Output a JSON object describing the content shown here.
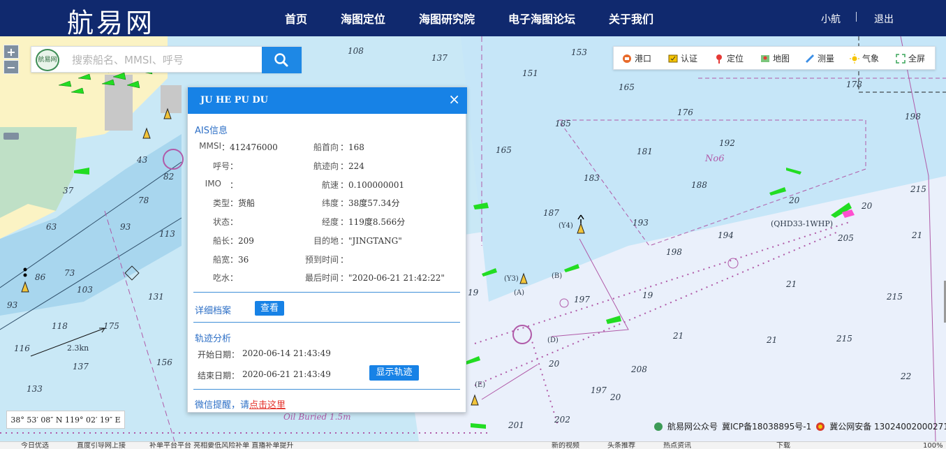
{
  "header": {
    "logo": "航易网",
    "nav": [
      "首页",
      "海图定位",
      "海图研究院",
      "电子海图论坛",
      "关于我们"
    ],
    "user": "小航",
    "logout": "退出"
  },
  "search": {
    "placeholder": "搜索船名、MMSI、呼号",
    "logo_text": "航易网"
  },
  "zoom": {
    "in": "+",
    "out": "−"
  },
  "toolbar": [
    {
      "label": "港口",
      "icon": "harbor-icon"
    },
    {
      "label": "认证",
      "icon": "certify-icon"
    },
    {
      "label": "定位",
      "icon": "location-pin-icon"
    },
    {
      "label": "地图",
      "icon": "map-icon"
    },
    {
      "label": "测量",
      "icon": "ruler-icon"
    },
    {
      "label": "气象",
      "icon": "sun-icon"
    },
    {
      "label": "全屏",
      "icon": "fullscreen-icon"
    }
  ],
  "popup": {
    "title": "JU HE PU DU",
    "close": "×",
    "ais_title": "AIS信息",
    "left_fields": [
      {
        "label": "MMSI",
        "value": "412476000"
      },
      {
        "label": "呼号",
        "value": ""
      },
      {
        "label": "IMO",
        "value": ""
      },
      {
        "label": "类型",
        "value": "货船"
      },
      {
        "label": "状态",
        "value": ""
      },
      {
        "label": "船长",
        "value": "209"
      },
      {
        "label": "船宽",
        "value": "36"
      },
      {
        "label": "吃水",
        "value": ""
      }
    ],
    "right_fields": [
      {
        "label": "船首向",
        "value": "168"
      },
      {
        "label": "航迹向",
        "value": "224"
      },
      {
        "label": "航速",
        "value": "0.100000001"
      },
      {
        "label": "纬度",
        "value": "38度57.34分"
      },
      {
        "label": "经度",
        "value": "119度8.566分"
      },
      {
        "label": "目的地",
        "value": "\"JINGTANG\""
      },
      {
        "label": "预到时间",
        "value": ""
      },
      {
        "label": "最后时间",
        "value": "\"2020-06-21 21:42:22\""
      }
    ],
    "detail_title": "详细档案",
    "detail_btn": "查看",
    "track_title": "轨迹分析",
    "start_label": "开始日期：",
    "start_value": "2020-06-14 21:43:49",
    "end_label": "结束日期：",
    "end_value": "2020-06-21 21:43:49",
    "track_btn": "显示轨迹",
    "wechat_prefix": "微信提醒，请",
    "wechat_link": "点击这里"
  },
  "coord": "38° 53′ 08″ N 119° 02′ 19″ E",
  "footer": {
    "wechat": "航易网公众号",
    "icp": "冀ICP备18038895号-1",
    "police": "冀公网安备 13024002000271号"
  },
  "map_labels": {
    "area": "No6",
    "station": "(QHD33-1WHP)",
    "buried": "Oil Buried 1.5m",
    "scale": "2.3kn",
    "marks": [
      "(Y4)",
      "(Y3)",
      "(A)",
      "(B)",
      "(D)",
      "(E)"
    ],
    "depths": [
      "108",
      "137",
      "153",
      "165",
      "178",
      "198",
      "151",
      "176",
      "192",
      "181",
      "188",
      "183",
      "165",
      "185",
      "215",
      "20",
      "20",
      "205",
      "21",
      "194",
      "193",
      "198",
      "187",
      "19",
      "197",
      "208",
      "21",
      "215",
      "21",
      "21",
      "215",
      "22",
      "197",
      "20",
      "202",
      "201",
      "20",
      "19",
      "175",
      "93",
      "113",
      "78",
      "63",
      "73",
      "86",
      "103",
      "93",
      "131",
      "118",
      "116",
      "137",
      "133",
      "156",
      "37",
      "82",
      "43"
    ]
  },
  "statusbar": [
    "今日优选",
    "直度引导网上接",
    "补单平台平台 亮相要低风险补单 直播补单提升",
    "新的视频",
    "头条推荐",
    "热点资讯",
    "下载",
    "100%"
  ]
}
